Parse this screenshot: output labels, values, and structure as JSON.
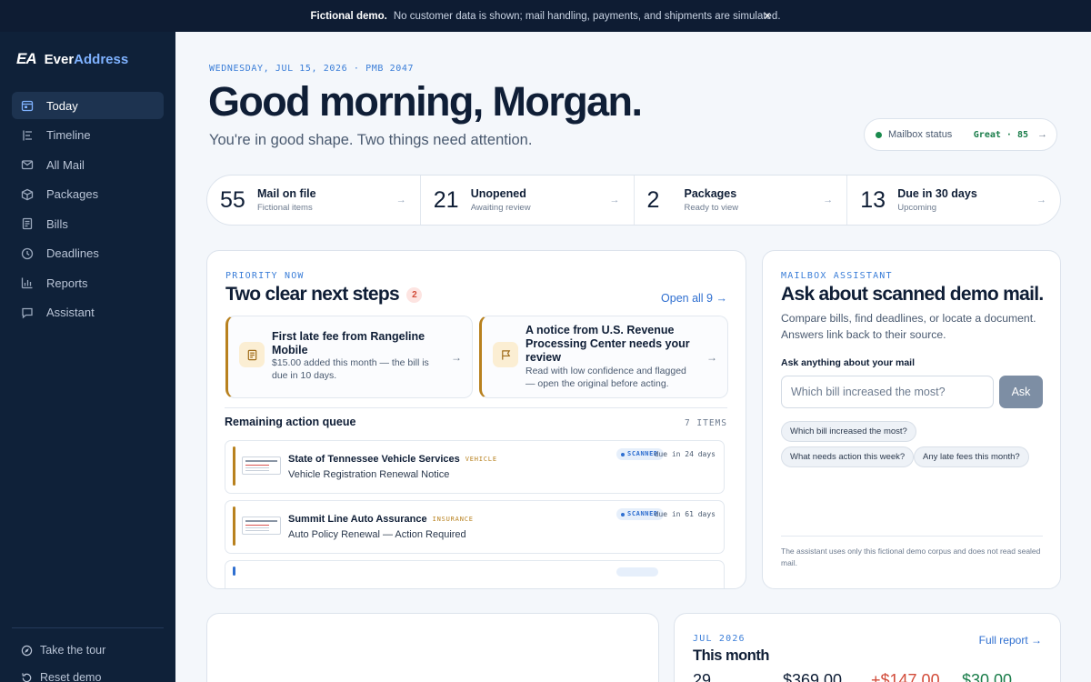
{
  "banner": {
    "bold": "Fictional demo.",
    "text": "No customer data is shown; mail handling, payments, and shipments are simulated.",
    "close": "×"
  },
  "brand": {
    "mark": "EA",
    "name_a": "Ever",
    "name_b": "Address"
  },
  "nav": [
    {
      "label": "Today",
      "icon": "calendar-icon",
      "active": true
    },
    {
      "label": "Timeline",
      "icon": "timeline-icon"
    },
    {
      "label": "All Mail",
      "icon": "mail-icon"
    },
    {
      "label": "Packages",
      "icon": "package-icon"
    },
    {
      "label": "Bills",
      "icon": "receipt-icon"
    },
    {
      "label": "Deadlines",
      "icon": "clock-icon"
    },
    {
      "label": "Reports",
      "icon": "chart-icon"
    },
    {
      "label": "Assistant",
      "icon": "chat-icon"
    }
  ],
  "sidebar_bottom": {
    "tour": "Take the tour",
    "reset": "Reset demo"
  },
  "header": {
    "date_line": "WEDNESDAY, JUL 15, 2026 · PMB 2047",
    "greeting": "Good morning, Morgan.",
    "subline": "You're in good shape. Two things need attention."
  },
  "status": {
    "label": "Mailbox status",
    "value": "Great · 85",
    "arrow": "→"
  },
  "stats": [
    {
      "num": "55",
      "title": "Mail on file",
      "sub": "Fictional items"
    },
    {
      "num": "21",
      "title": "Unopened",
      "sub": "Awaiting review"
    },
    {
      "num": "2",
      "title": "Packages",
      "sub": "Ready to view"
    },
    {
      "num": "13",
      "title": "Due in 30 days",
      "sub": "Upcoming"
    }
  ],
  "priority": {
    "eyebrow": "PRIORITY NOW",
    "title": "Two clear next steps",
    "count": "2",
    "open_all": "Open all 9 →",
    "steps": [
      {
        "title": "First late fee from Rangeline Mobile",
        "desc": "$15.00 added this month — the bill is due in 10 days.",
        "icon": "receipt-icon"
      },
      {
        "title": "A notice from U.S. Revenue Processing Center needs your review",
        "desc": "Read with low confidence and flagged — open the original before acting.",
        "icon": "flag-icon"
      }
    ],
    "queue_title": "Remaining action queue",
    "queue_count": "7 ITEMS",
    "queue": [
      {
        "sender": "State of Tennessee Vehicle Services",
        "tag": "VEHICLE",
        "subject": "Vehicle Registration Renewal Notice",
        "status": "SCANNED",
        "due": "due in 24 days"
      },
      {
        "sender": "Summit Line Auto Assurance",
        "tag": "INSURANCE",
        "subject": "Auto Policy Renewal — Action Required",
        "status": "SCANNED",
        "due": "due in 61 days"
      }
    ]
  },
  "assistant": {
    "eyebrow": "MAILBOX ASSISTANT",
    "title": "Ask about scanned demo mail.",
    "desc": "Compare bills, find deadlines, or locate a document. Answers link back to their source.",
    "label": "Ask anything about your mail",
    "placeholder": "Which bill increased the most?",
    "button": "Ask",
    "chips": [
      "Which bill increased the most?",
      "What needs action this week?",
      "Any late fees this month?"
    ],
    "note": "The assistant uses only this fictional demo corpus and does not read sealed mail."
  },
  "month": {
    "eyebrow": "JUL 2026",
    "title": "This month",
    "full_report": "Full report →",
    "values": [
      "29",
      "$369.00",
      "+$147.00",
      "$30.00"
    ],
    "colors": [
      "#0f1e36",
      "#0f1e36",
      "#d24b39",
      "#1a7d4a"
    ]
  }
}
